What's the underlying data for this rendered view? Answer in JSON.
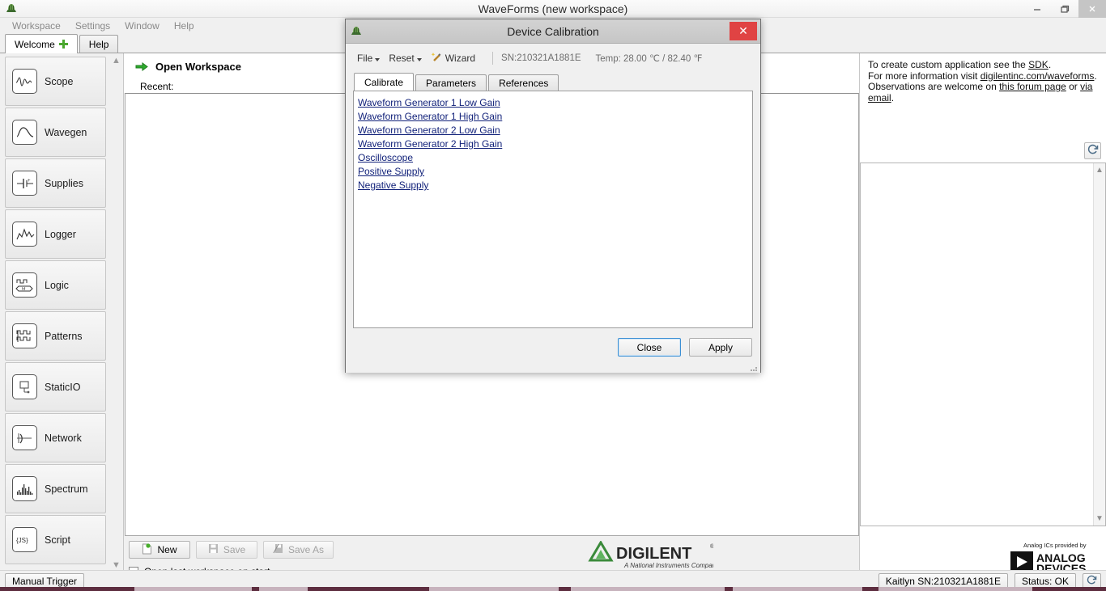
{
  "window": {
    "title": "WaveForms  (new workspace)",
    "icon": "waveforms-app-icon",
    "controls": {
      "minimize": "minimize-icon",
      "restore": "restore-icon",
      "close": "close-icon"
    }
  },
  "menubar": {
    "items": [
      "Workspace",
      "Settings",
      "Window",
      "Help"
    ]
  },
  "tabs": [
    {
      "label": "Welcome",
      "active": true,
      "has_plus": true
    },
    {
      "label": "Help",
      "active": false,
      "has_plus": false
    }
  ],
  "sidebar": {
    "items": [
      {
        "label": "Scope",
        "icon": "scope-icon"
      },
      {
        "label": "Wavegen",
        "icon": "wavegen-icon"
      },
      {
        "label": "Supplies",
        "icon": "supplies-icon"
      },
      {
        "label": "Logger",
        "icon": "logger-icon"
      },
      {
        "label": "Logic",
        "icon": "logic-icon"
      },
      {
        "label": "Patterns",
        "icon": "patterns-icon"
      },
      {
        "label": "StaticIO",
        "icon": "staticio-icon"
      },
      {
        "label": "Network",
        "icon": "network-icon"
      },
      {
        "label": "Spectrum",
        "icon": "spectrum-icon"
      },
      {
        "label": "Script",
        "icon": "script-icon"
      }
    ],
    "scroll_up": "▲",
    "scroll_down": "▼"
  },
  "workspace": {
    "open_label": "Open Workspace",
    "recent_label": "Recent:",
    "buttons": [
      {
        "label": "New",
        "icon": "new-doc-icon",
        "enabled": true
      },
      {
        "label": "Save",
        "icon": "floppy-icon",
        "enabled": false
      },
      {
        "label": "Save As",
        "icon": "save-as-icon",
        "enabled": false
      }
    ],
    "checkbox": {
      "label": "Open last workspace on start",
      "checked": false
    }
  },
  "branding": {
    "digilent": {
      "name": "DIGILENT",
      "tagline": "A National Instruments Company"
    },
    "analog": {
      "prefix": "Analog ICs provided by",
      "line1": "ANALOG",
      "line2": "DEVICES"
    }
  },
  "info_panel": {
    "line1_pre": "To create custom application see the ",
    "line1_link": "SDK",
    "line1_post": ".",
    "line2_pre": "For more information visit ",
    "line2_link": "digilentinc.com/waveforms",
    "line2_post": ".",
    "line3_pre": "Observations are welcome on ",
    "line3_link1": "this forum page",
    "line3_mid": " or ",
    "line3_link2": "via email",
    "line3_post": ".",
    "refresh_icon": "refresh-icon"
  },
  "statusbar": {
    "manual_trigger": "Manual Trigger",
    "device": "Kaitlyn SN:210321A1881E",
    "status": "Status: OK",
    "settings_icon": "device-settings-icon"
  },
  "dialog": {
    "title": "Device Calibration",
    "icon": "waveforms-app-icon",
    "close_label": "✕",
    "toolbar": {
      "file": "File",
      "reset": "Reset",
      "wizard": "Wizard",
      "wizard_icon": "magic-wand-icon",
      "serial": "SN:210321A1881E",
      "temperature": "Temp: 28.00 ℃ / 82.40 ℉"
    },
    "tabs": [
      {
        "label": "Calibrate",
        "active": true
      },
      {
        "label": "Parameters",
        "active": false
      },
      {
        "label": "References",
        "active": false
      }
    ],
    "calibration_links": [
      "Waveform Generator 1 Low Gain",
      "Waveform Generator 1 High Gain",
      "Waveform Generator 2 Low Gain",
      "Waveform Generator 2 High Gain",
      "Oscilloscope",
      "Positive Supply",
      "Negative Supply"
    ],
    "actions": [
      {
        "label": "Close",
        "focused": true
      },
      {
        "label": "Apply",
        "focused": false
      }
    ]
  },
  "colors": {
    "accent_red": "#e04343",
    "link_blue": "#12227a",
    "green": "#4aa72e",
    "taskbar": "#5d2d3f"
  }
}
